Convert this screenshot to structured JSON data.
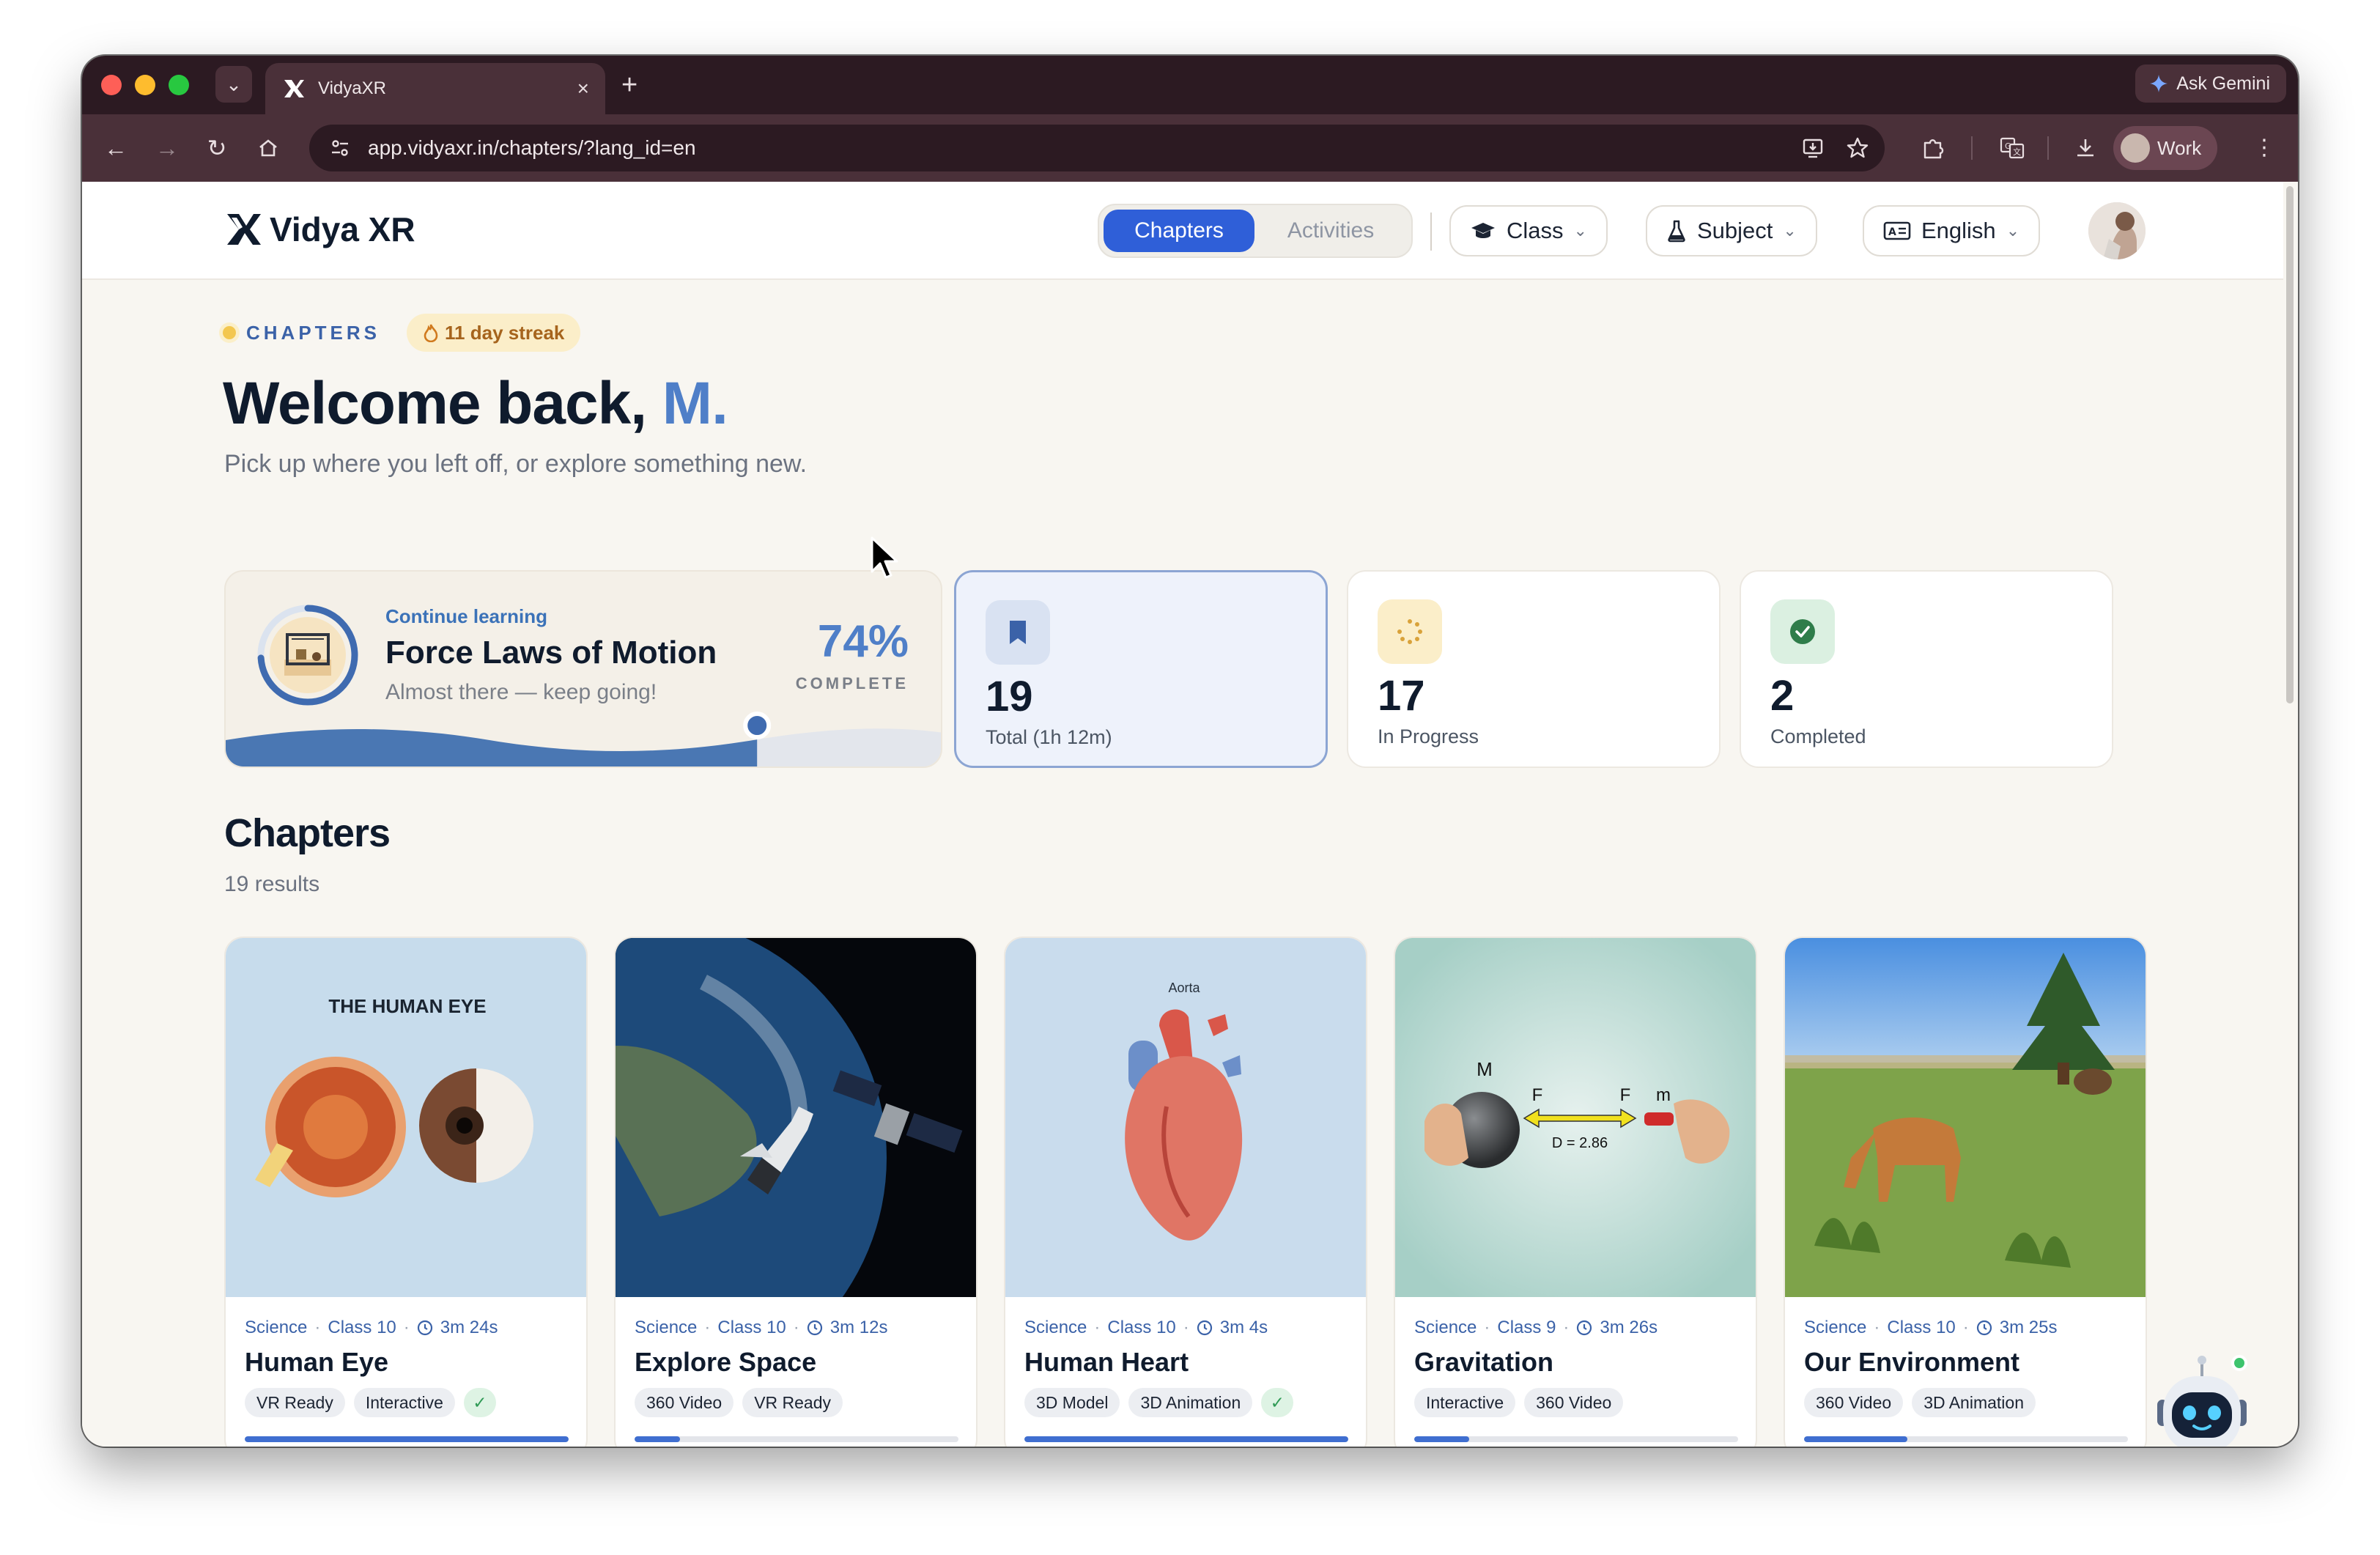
{
  "browser": {
    "tab_title": "VidyaXR",
    "tab_close": "×",
    "new_tab": "+",
    "url": "app.vidyaxr.in/chapters/?lang_id=en",
    "ask_gemini": "Ask Gemini",
    "profile": "Work"
  },
  "header": {
    "logo": "Vidya XR",
    "tabs": [
      {
        "label": "Chapters",
        "active": true
      },
      {
        "label": "Activities",
        "active": false
      }
    ],
    "filters": {
      "class": "Class",
      "subject": "Subject",
      "language": "English"
    }
  },
  "hero": {
    "eyebrow": "CHAPTERS",
    "streak": "11 day streak",
    "welcome_prefix": "Welcome back, ",
    "welcome_name": "M.",
    "subtitle": "Pick up where you left off, or explore something new."
  },
  "continue": {
    "label": "Continue learning",
    "title": "Force Laws of Motion",
    "subtitle": "Almost there — keep going!",
    "percent_label": "74%",
    "complete_label": "COMPLETE",
    "progress": 0.74
  },
  "stats": [
    {
      "value": "19",
      "label": "Total (1h 12m)",
      "icon": "bookmark-icon",
      "selected": true
    },
    {
      "value": "17",
      "label": "In Progress",
      "icon": "loading-dots-icon",
      "selected": false
    },
    {
      "value": "2",
      "label": "Completed",
      "icon": "check-circle-icon",
      "selected": false
    }
  ],
  "chapters_section": {
    "title": "Chapters",
    "results": "19 results"
  },
  "cards": [
    {
      "subject": "Science",
      "class": "Class 10",
      "duration": "3m 24s",
      "title": "Human Eye",
      "tags": [
        "VR Ready",
        "Interactive"
      ],
      "completed": true,
      "progress": 1.0,
      "thumb_text": "THE HUMAN EYE"
    },
    {
      "subject": "Science",
      "class": "Class 10",
      "duration": "3m 12s",
      "title": "Explore Space",
      "tags": [
        "360 Video",
        "VR Ready"
      ],
      "completed": false,
      "progress": 0.14
    },
    {
      "subject": "Science",
      "class": "Class 10",
      "duration": "3m 4s",
      "title": "Human Heart",
      "tags": [
        "3D Model",
        "3D Animation"
      ],
      "completed": true,
      "progress": 1.0,
      "thumb_text": "Aorta"
    },
    {
      "subject": "Science",
      "class": "Class 9",
      "duration": "3m 26s",
      "title": "Gravitation",
      "tags": [
        "Interactive",
        "360 Video"
      ],
      "completed": false,
      "progress": 0.17,
      "thumb_labels": [
        "M",
        "F",
        "F",
        "m",
        "D = 2.86"
      ]
    },
    {
      "subject": "Science",
      "class": "Class 10",
      "duration": "3m 25s",
      "title": "Our Environment",
      "tags": [
        "360 Video",
        "3D Animation"
      ],
      "completed": false,
      "progress": 0.32
    }
  ],
  "colors": {
    "accent": "#2f5fd8",
    "brand_blue": "#4f7fc8",
    "streak": "#a6641d",
    "success": "#2f9a55"
  }
}
